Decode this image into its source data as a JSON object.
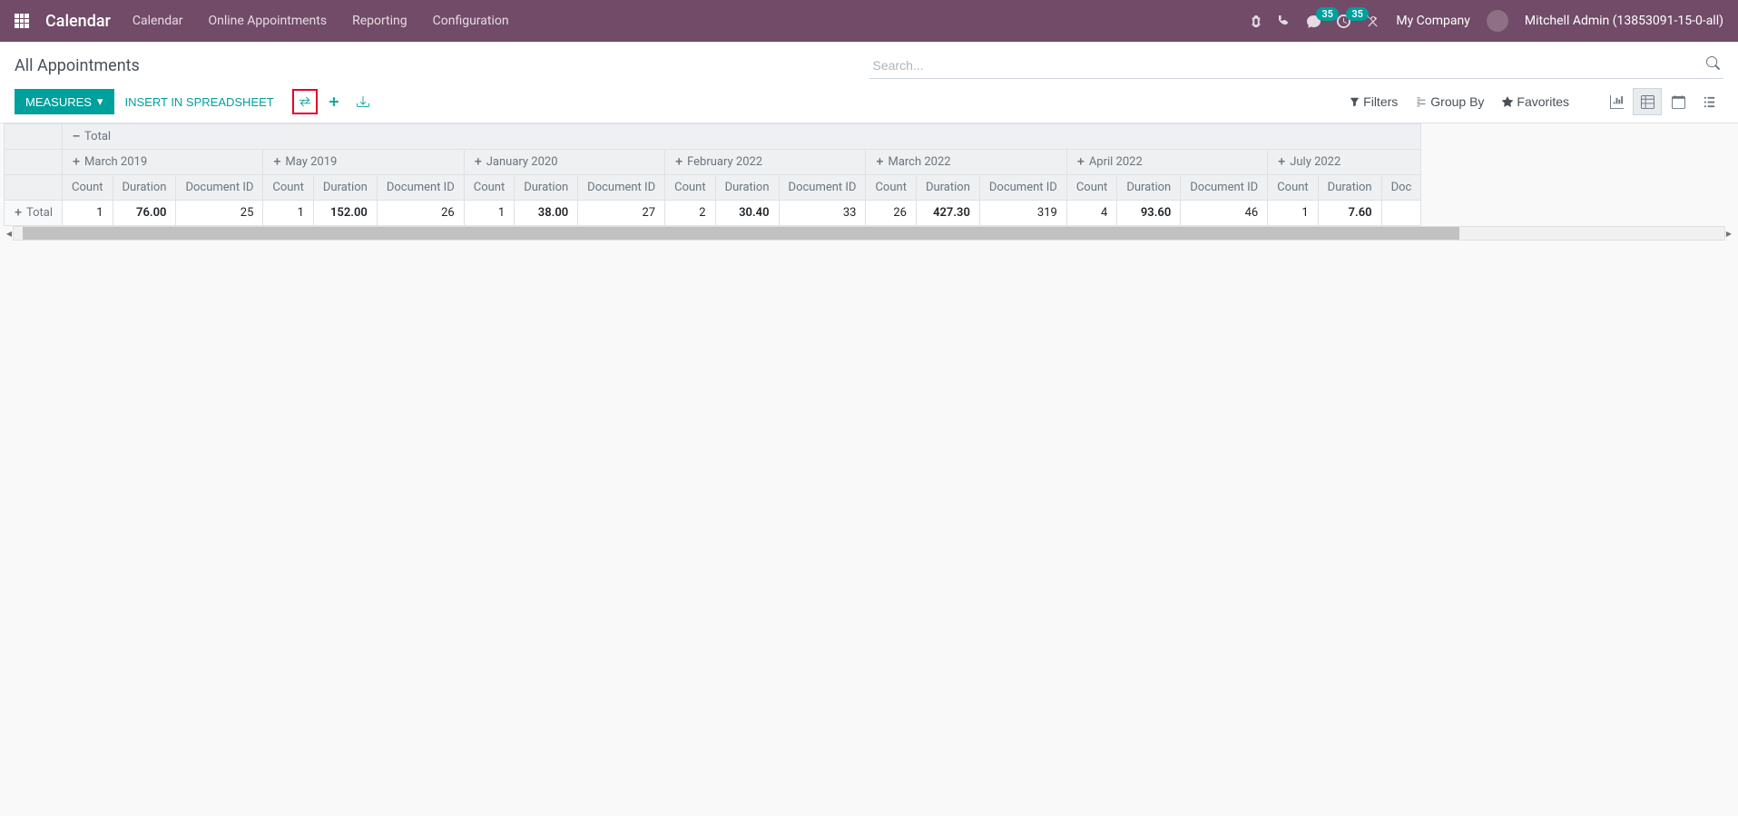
{
  "nav": {
    "brand": "Calendar",
    "menu": [
      "Calendar",
      "Online Appointments",
      "Reporting",
      "Configuration"
    ],
    "badge1": "35",
    "badge2": "35",
    "company": "My Company",
    "user": "Mitchell Admin (13853091-15-0-all)"
  },
  "cp": {
    "breadcrumb": "All Appointments",
    "search_placeholder": "Search...",
    "measures": "MEASURES",
    "insert": "INSERT IN SPREADSHEET",
    "filters": "Filters",
    "groupby": "Group By",
    "favorites": "Favorites"
  },
  "pivot": {
    "total_label": "Total",
    "row_label": "Total",
    "measures": [
      "Count",
      "Duration",
      "Document ID"
    ],
    "columns": [
      {
        "label": "March 2019",
        "count": "1",
        "duration": "76.00",
        "docid": "25"
      },
      {
        "label": "May 2019",
        "count": "1",
        "duration": "152.00",
        "docid": "26"
      },
      {
        "label": "January 2020",
        "count": "1",
        "duration": "38.00",
        "docid": "27"
      },
      {
        "label": "February 2022",
        "count": "2",
        "duration": "30.40",
        "docid": "33"
      },
      {
        "label": "March 2022",
        "count": "26",
        "duration": "427.30",
        "docid": "319"
      },
      {
        "label": "April 2022",
        "count": "4",
        "duration": "93.60",
        "docid": "46"
      },
      {
        "label": "July 2022",
        "count": "1",
        "duration": "7.60",
        "docid": ""
      }
    ],
    "last_partial_measure": "Doc"
  }
}
